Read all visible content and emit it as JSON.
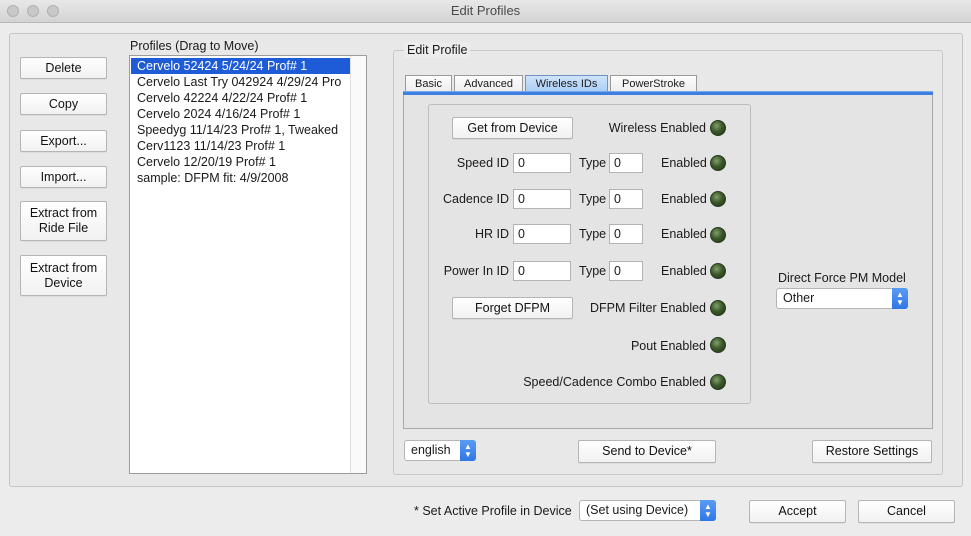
{
  "window": {
    "title": "Edit Profiles"
  },
  "left_buttons": {
    "delete": "Delete",
    "copy": "Copy",
    "export": "Export...",
    "import": "Import...",
    "extract_ride": "Extract from\nRide File",
    "extract_device": "Extract from\nDevice"
  },
  "profiles": {
    "label": "Profiles (Drag to Move)",
    "items": [
      "Cervelo 52424 5/24/24 Prof# 1",
      "Cervelo Last Try 042924 4/29/24 Pro",
      "Cervelo 42224 4/22/24 Prof# 1",
      "Cervelo 2024 4/16/24 Prof# 1",
      "Speedyg 11/14/23 Prof# 1, Tweaked",
      "Cerv1123 11/14/23 Prof# 1",
      "Cervelo 12/20/19 Prof# 1",
      "sample: DFPM fit: 4/9/2008"
    ],
    "selected_index": 0
  },
  "edit_profile": {
    "label": "Edit Profile",
    "tabs": [
      "Basic",
      "Advanced",
      "Wireless IDs",
      "PowerStroke"
    ],
    "active_tab": "Wireless IDs",
    "get_from_device": "Get from Device",
    "wireless_enabled": "Wireless Enabled",
    "type_label": "Type",
    "enabled_label": "Enabled",
    "speed_id": {
      "label": "Speed ID",
      "value": "0",
      "type": "0"
    },
    "cadence_id": {
      "label": "Cadence ID",
      "value": "0",
      "type": "0"
    },
    "hr_id": {
      "label": "HR ID",
      "value": "0",
      "type": "0"
    },
    "power_in_id": {
      "label": "Power In ID",
      "value": "0",
      "type": "0"
    },
    "forget_dfpm": "Forget DFPM",
    "dfpm_filter_enabled": "DFPM Filter Enabled",
    "pout_enabled": "Pout Enabled",
    "combo_enabled": "Speed/Cadence Combo Enabled",
    "dfpm_model_label": "Direct Force PM Model",
    "dfpm_model_value": "Other",
    "language_value": "english",
    "send_to_device": "Send to Device*",
    "restore_settings": "Restore Settings"
  },
  "footer": {
    "active_profile_label": "* Set Active Profile in Device",
    "active_profile_value": "(Set using Device)",
    "accept": "Accept",
    "cancel": "Cancel"
  },
  "colors": {
    "selection": "#1e5bd6",
    "tab_active": "#a9cdf6",
    "led_off": "#3c5a2c"
  }
}
